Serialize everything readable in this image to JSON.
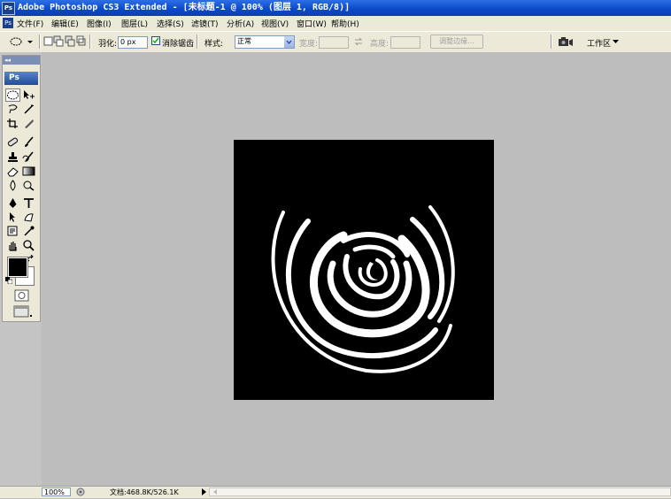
{
  "window": {
    "title": "Adobe Photoshop CS3 Extended - [未标题-1 @ 100% (图层 1, RGB/8)]",
    "app_icon": "Ps"
  },
  "menu": {
    "app_icon": "Ps",
    "items": [
      {
        "label": "文件(F)"
      },
      {
        "label": "编辑(E)"
      },
      {
        "label": "图像(I)"
      },
      {
        "label": "图层(L)"
      },
      {
        "label": "选择(S)"
      },
      {
        "label": "滤镜(T)"
      },
      {
        "label": "分析(A)"
      },
      {
        "label": "视图(V)"
      },
      {
        "label": "窗口(W)"
      },
      {
        "label": "帮助(H)"
      }
    ]
  },
  "options": {
    "feather_label": "羽化:",
    "feather_value": "0 px",
    "antialias_label": "消除锯齿",
    "antialias_checked": true,
    "style_label": "样式:",
    "style_value": "正常",
    "width_label": "宽度:",
    "height_label": "高度:",
    "refine_edge_label": "调整边缘...",
    "workspace_label": "工作区"
  },
  "toolbox": {
    "collapse": "◂◂",
    "logo": "Ps"
  },
  "status": {
    "zoom": "100%",
    "doc_info": "文档:468.8K/526.1K"
  },
  "colors": {
    "foreground": "#000000",
    "background": "#ffffff",
    "canvas": "#000000"
  }
}
